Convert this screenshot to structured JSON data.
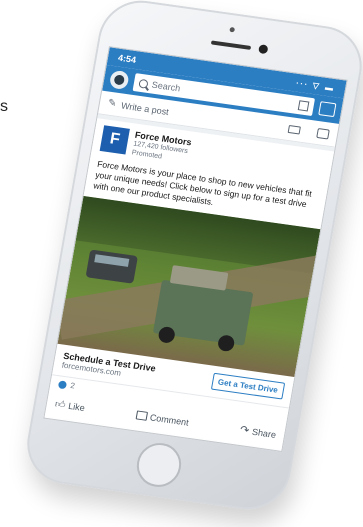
{
  "edge_glyph": "s",
  "status_bar": {
    "time": "4:54",
    "icons": "∙∙∙ ▽ ▬"
  },
  "search": {
    "placeholder": "Search"
  },
  "compose": {
    "placeholder": "Write a post"
  },
  "post": {
    "logo_letter": "F",
    "company": "Force Motors",
    "followers": "127,420 followers",
    "tag": "Promoted",
    "text": "Force Motors is your place to shop to new vehicles that fit your unique needs! Click below to sign up for a test drive with one our product specialists.",
    "cta_title": "Schedule a Test Drive",
    "cta_url": "forcemotors.com",
    "cta_button": "Get a Test Drive",
    "reaction_count": "2"
  },
  "actions": {
    "like": "Like",
    "comment": "Comment",
    "share": "Share"
  },
  "colors": {
    "brand_blue": "#2c7ec3",
    "logo_blue": "#1d5fae"
  }
}
